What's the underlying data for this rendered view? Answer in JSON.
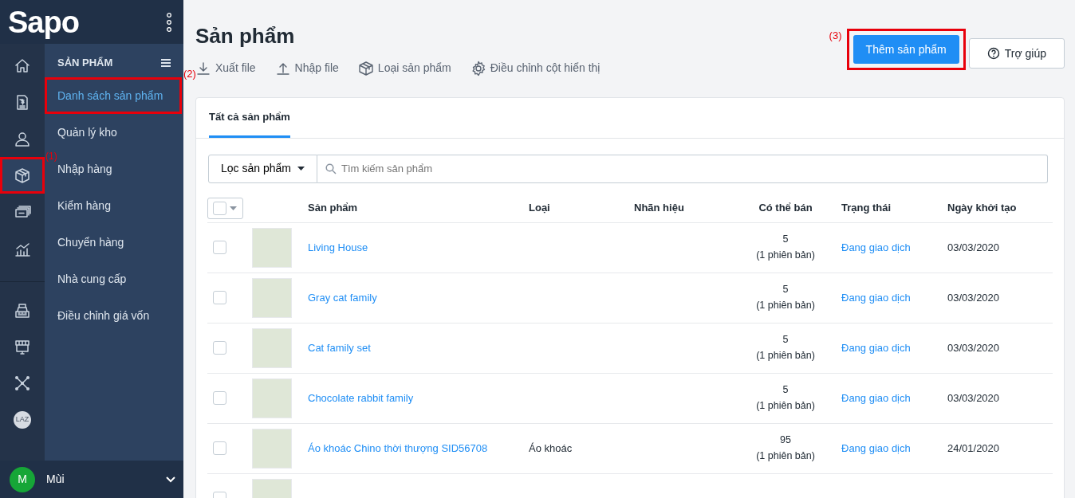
{
  "brand": {
    "logo": "Sapo"
  },
  "rail": {
    "items": [
      {
        "selected": false
      },
      {
        "selected": false
      },
      {
        "selected": false
      },
      {
        "selected": true,
        "callout": "(1)"
      },
      {
        "selected": false
      },
      {
        "selected": false
      }
    ],
    "apps": [
      {
        "kind": "icon"
      },
      {
        "kind": "icon"
      },
      {
        "kind": "icon"
      },
      {
        "kind": "badge",
        "label": "LAZ"
      }
    ]
  },
  "menu": {
    "title": "SẢN PHẨM",
    "items": [
      {
        "label": "Danh sách sản phẩm",
        "selected": true,
        "callout": "(2)"
      },
      {
        "label": "Quản lý kho",
        "selected": false
      },
      {
        "label": "Nhập hàng",
        "selected": false
      },
      {
        "label": "Kiểm hàng",
        "selected": false
      },
      {
        "label": "Chuyển hàng",
        "selected": false
      },
      {
        "label": "Nhà cung cấp",
        "selected": false
      },
      {
        "label": "Điều chỉnh giá vốn",
        "selected": false
      }
    ]
  },
  "user": {
    "initial": "M",
    "name": "Mùi"
  },
  "page": {
    "title": "Sản phẩm",
    "actions": [
      {
        "label": "Xuất file"
      },
      {
        "label": "Nhập file"
      },
      {
        "label": "Loại sản phẩm"
      },
      {
        "label": "Điều chỉnh cột hiển thị"
      }
    ],
    "buttons": [
      {
        "kind": "primary",
        "label": "Thêm sản phẩm",
        "callout": "(3)"
      },
      {
        "kind": "help",
        "label": "Trợ giúp"
      }
    ]
  },
  "tabs": [
    {
      "label": "Tất cả sản phẩm",
      "selected": true
    }
  ],
  "filter": {
    "label": "Lọc sản phẩm",
    "placeholder": "Tìm kiếm sản phẩm"
  },
  "table": {
    "select_all": {
      "checked": false
    },
    "columns": [
      "Sản phẩm",
      "Loại",
      "Nhãn hiệu",
      "Có thể bán",
      "Trạng thái",
      "Ngày khởi tạo"
    ],
    "rows": [
      {
        "checked": false,
        "name": "Living House",
        "available": "5",
        "variants": "(1 phiên bản)",
        "status": "Đang giao dịch",
        "created": "03/03/2020"
      },
      {
        "checked": false,
        "name": "Gray cat family",
        "available": "5",
        "variants": "(1 phiên bản)",
        "status": "Đang giao dịch",
        "created": "03/03/2020"
      },
      {
        "checked": false,
        "name": "Cat family set",
        "available": "5",
        "variants": "(1 phiên bản)",
        "status": "Đang giao dịch",
        "created": "03/03/2020"
      },
      {
        "checked": false,
        "name": "Chocolate rabbit family",
        "available": "5",
        "variants": "(1 phiên bản)",
        "status": "Đang giao dịch",
        "created": "03/03/2020"
      },
      {
        "checked": false,
        "name": "Áo khoác Chino thời thượng SID56708",
        "type": "Áo khoác",
        "available": "95",
        "variants": "(1 phiên bản)",
        "status": "Đang giao dịch",
        "created": "24/01/2020"
      },
      {
        "checked": false
      }
    ]
  }
}
